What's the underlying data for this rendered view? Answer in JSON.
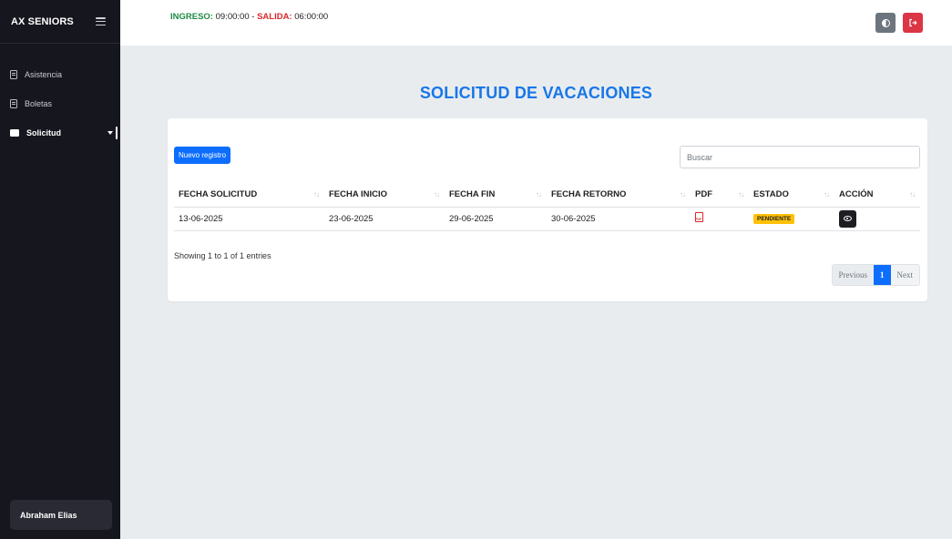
{
  "sidebar": {
    "brand": "AX SENIORS",
    "items": [
      {
        "label": "Asistencia",
        "icon": "document-icon"
      },
      {
        "label": "Boletas",
        "icon": "document-icon"
      },
      {
        "label": "Solicitud",
        "icon": "folder-icon"
      }
    ],
    "user": "Abraham Elias"
  },
  "topbar": {
    "ingreso_label": "INGRESO:",
    "ingreso_value": "09:00:00",
    "separator": " - ",
    "salida_label": "SALIDA:",
    "salida_value": "06:00:00",
    "theme_icon": "contrast-icon",
    "logout_icon": "logout-icon",
    "colors": {
      "ingreso": "#1e8a45",
      "salida": "#d9272e",
      "logout": "#dc3545",
      "theme": "#6c757d"
    }
  },
  "main": {
    "title": "SOLICITUD DE VACACIONES",
    "new_button": "Nuevo registro",
    "search_placeholder": "Buscar",
    "table": {
      "headers": [
        "FECHA SOLICITUD",
        "FECHA INICIO",
        "FECHA FIN",
        "FECHA RETORNO",
        "PDF",
        "ESTADO",
        "ACCIÓN"
      ],
      "rows": [
        {
          "fecha_solicitud": "13-06-2025",
          "fecha_inicio": "23-06-2025",
          "fecha_fin": "29-06-2025",
          "fecha_retorno": "30-06-2025",
          "pdf_icon": "pdf-icon",
          "estado": "PENDIENTE",
          "accion_icon": "eye-icon"
        }
      ]
    },
    "info": "Showing 1 to 1 of 1 entries",
    "pagination": {
      "previous": "Previous",
      "current": "1",
      "next": "Next"
    },
    "accent": "#1877e8"
  }
}
